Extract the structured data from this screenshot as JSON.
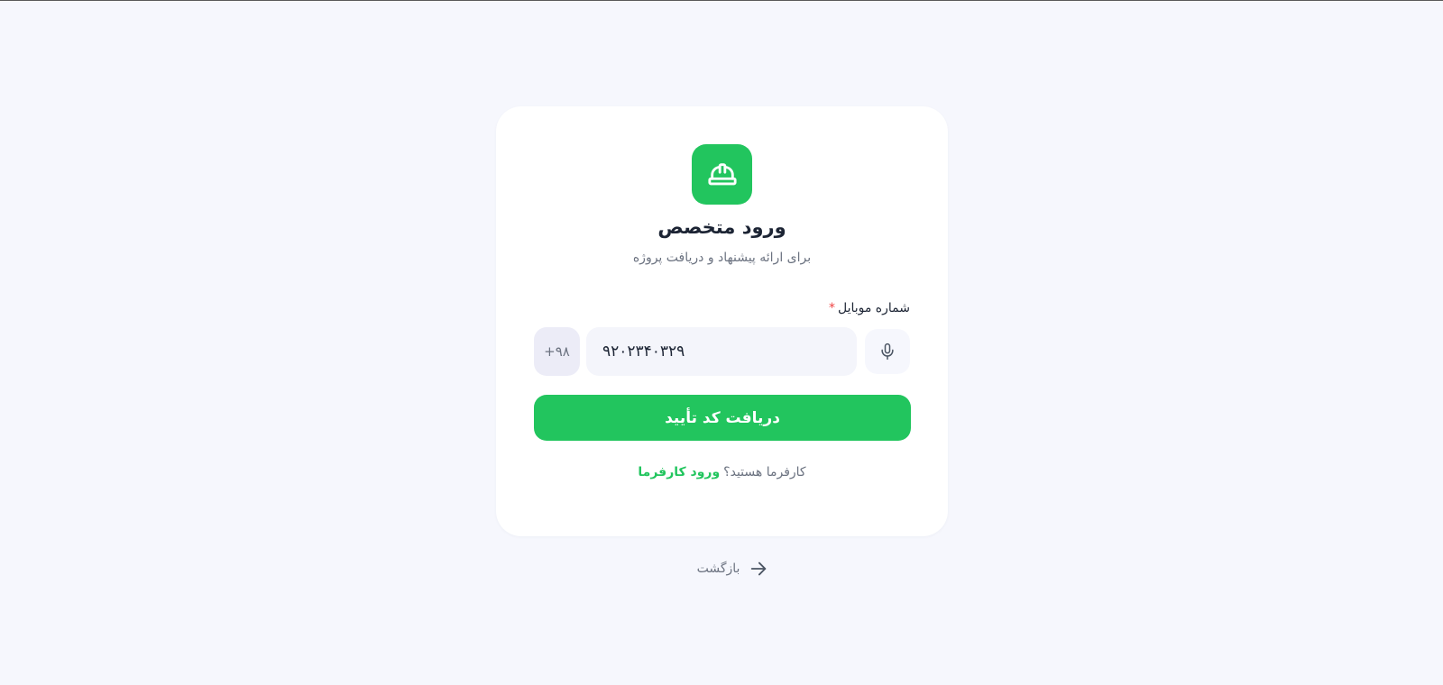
{
  "login": {
    "title": "ورود متخصص",
    "subtitle": "برای ارائه پیشنهاد و دریافت پروژه",
    "phone_label": "شماره موبایل",
    "required_mark": "*",
    "phone_value": "۹۲۰۲۳۴۰۳۲۹",
    "country_code": "+۹۸",
    "submit_label": "دریافت کد تأیید",
    "switch_question": "کارفرما هستید؟",
    "switch_link": "ورود کارفرما"
  },
  "back": {
    "label": "بازگشت"
  },
  "icons": {
    "logo": "hard-hat-icon",
    "voice": "microphone-icon",
    "back": "arrow-right-icon"
  },
  "colors": {
    "accent": "#22c55e",
    "background": "#f6f7fd",
    "card": "#ffffff",
    "required": "#ef4444"
  }
}
